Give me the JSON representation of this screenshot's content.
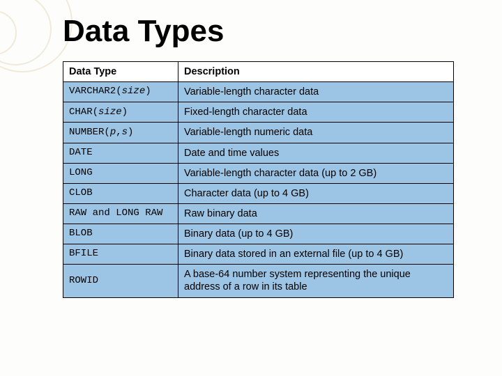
{
  "title": "Data Types",
  "headers": {
    "col1": "Data Type",
    "col2": "Description"
  },
  "rows": [
    {
      "type_html": "VARCHAR2(<span class=\"param\">size</span>)",
      "desc": "Variable-length character data"
    },
    {
      "type_html": "CHAR(<span class=\"param\">size</span>)",
      "desc": "Fixed-length character data"
    },
    {
      "type_html": "NUMBER(<span class=\"param\">p</span>,<span class=\"param\">s</span>)",
      "desc": "Variable-length numeric data"
    },
    {
      "type_html": "DATE",
      "desc": "Date and time values"
    },
    {
      "type_html": "LONG",
      "desc": "Variable-length character data (up to 2 GB)"
    },
    {
      "type_html": "CLOB",
      "desc": "Character data (up to 4 GB)"
    },
    {
      "type_html": "RAW and LONG RAW",
      "desc": "Raw binary data"
    },
    {
      "type_html": "BLOB",
      "desc": "Binary data (up to 4 GB)"
    },
    {
      "type_html": "BFILE",
      "desc": "Binary data stored in an external file (up to 4 GB)"
    },
    {
      "type_html": "ROWID",
      "desc": "A base-64 number system representing the unique address of a row in its table"
    }
  ]
}
